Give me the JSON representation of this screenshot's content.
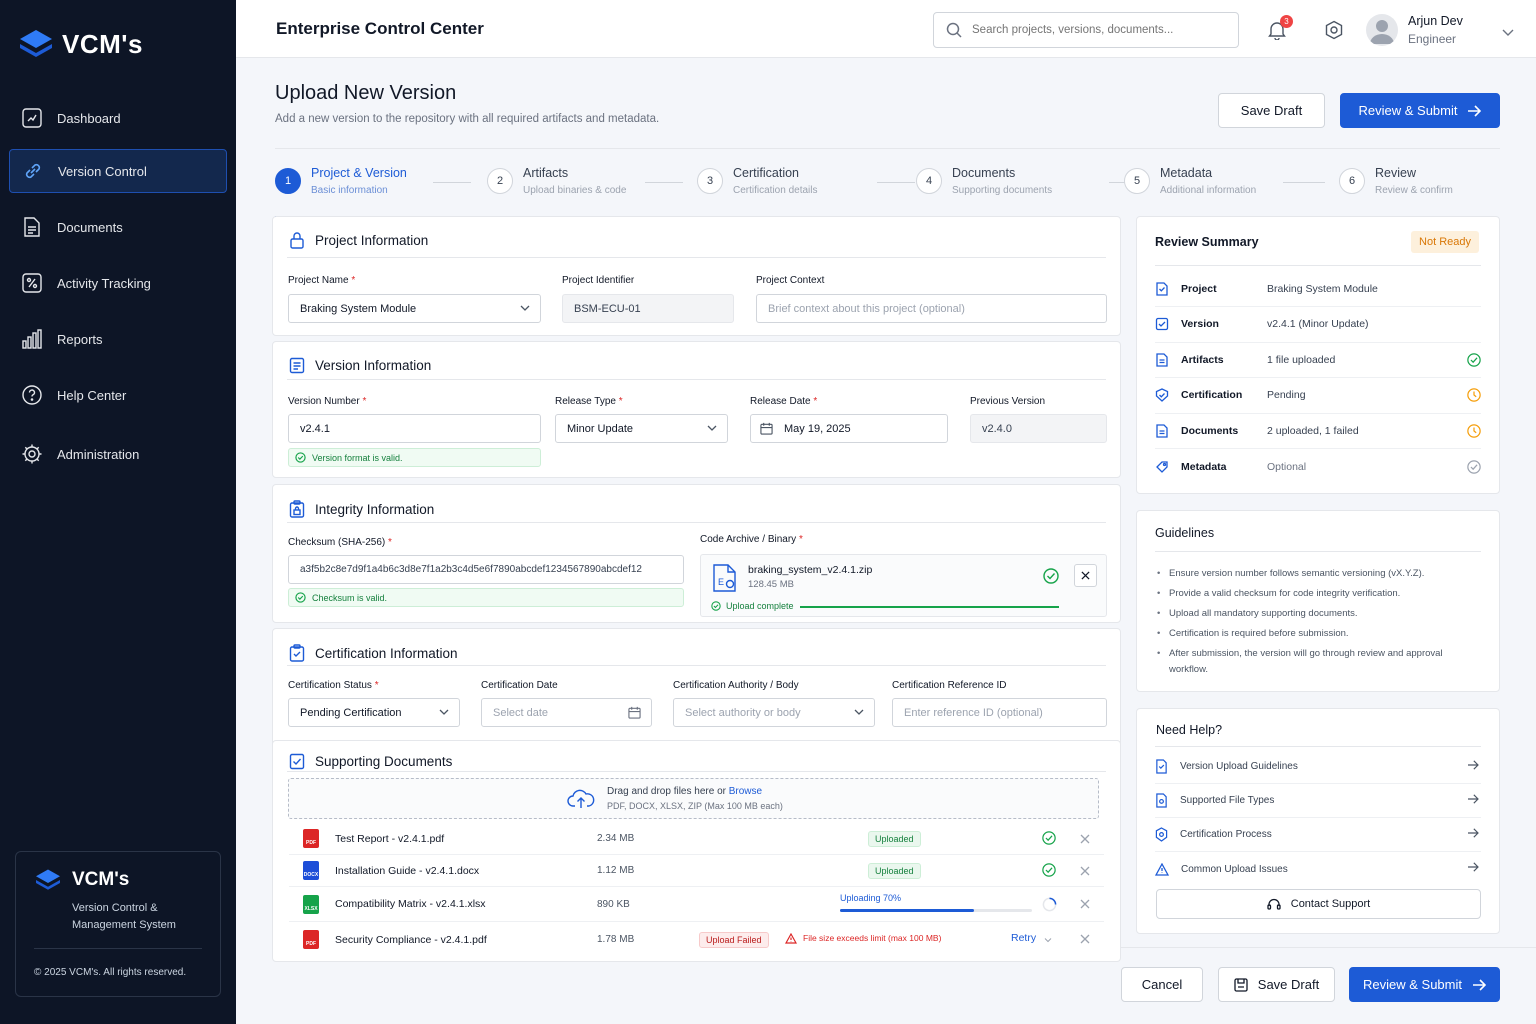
{
  "brand": {
    "name": "VCM's",
    "tagline": "Version Control & Management System",
    "copyright": "© 2025 VCM's. All rights reserved."
  },
  "nav": [
    {
      "label": "Dashboard",
      "icon": "dashboard-icon"
    },
    {
      "label": "Version Control",
      "icon": "link-icon",
      "active": true
    },
    {
      "label": "Documents",
      "icon": "document-icon"
    },
    {
      "label": "Activity Tracking",
      "icon": "activity-icon"
    },
    {
      "label": "Reports",
      "icon": "bar-chart-icon"
    },
    {
      "label": "Help Center",
      "icon": "help-icon"
    },
    {
      "label": "Administration",
      "icon": "gear-icon"
    }
  ],
  "header": {
    "title": "Enterprise Control Center",
    "search_placeholder": "Search projects, versions, documents...",
    "notifications": "3",
    "user_name": "Arjun Dev",
    "user_role": "Engineer"
  },
  "page": {
    "title": "Upload New Version",
    "subtitle": "Add a new version to the repository with all required artifacts and metadata.",
    "save_draft": "Save Draft",
    "review_submit": "Review & Submit"
  },
  "steps": [
    {
      "num": "1",
      "title": "Project & Version",
      "sub": "Basic information"
    },
    {
      "num": "2",
      "title": "Artifacts",
      "sub": "Upload binaries & code"
    },
    {
      "num": "3",
      "title": "Certification",
      "sub": "Certification details"
    },
    {
      "num": "4",
      "title": "Documents",
      "sub": "Supporting documents"
    },
    {
      "num": "5",
      "title": "Metadata",
      "sub": "Additional information"
    },
    {
      "num": "6",
      "title": "Review",
      "sub": "Review & confirm"
    }
  ],
  "project": {
    "title": "Project Information",
    "name_label": "Project Name",
    "name_value": "Braking System Module",
    "id_label": "Project Identifier",
    "id_value": "BSM-ECU-01",
    "context_label": "Project Context",
    "context_placeholder": "Brief context about this project (optional)"
  },
  "version": {
    "title": "Version Information",
    "number_label": "Version Number",
    "number_value": "v2.4.1",
    "valid": "Version format is valid.",
    "type_label": "Release Type",
    "type_value": "Minor Update",
    "date_label": "Release Date",
    "date_value": "May 19, 2025",
    "prev_label": "Previous Version",
    "prev_value": "v2.4.0"
  },
  "integrity": {
    "title": "Integrity Information",
    "checksum_label": "Checksum (SHA-256)",
    "checksum_value": "a3f5b2c8e7d9f1a4b6c3d8e7f1a2b3c4d5e6f7890abcdef1234567890abcdef12",
    "checksum_valid": "Checksum is valid.",
    "archive_label": "Code Archive / Binary",
    "file_name": "braking_system_v2.4.1.zip",
    "file_size": "128.45 MB",
    "upload_status": "Upload complete",
    "upload_progress": 1.0
  },
  "certification": {
    "title": "Certification Information",
    "status_label": "Certification Status",
    "status_value": "Pending Certification",
    "date_label": "Certification Date",
    "date_placeholder": "Select date",
    "authority_label": "Certification Authority / Body",
    "authority_placeholder": "Select authority or body",
    "ref_label": "Certification Reference ID",
    "ref_placeholder": "Enter reference ID (optional)"
  },
  "documents": {
    "title": "Supporting Documents",
    "drop_text": "Drag and drop files here or",
    "browse": "Browse",
    "formats": "PDF, DOCX, XLSX, ZIP (Max 100 MB each)",
    "files": [
      {
        "name": "Test Report - v2.4.1.pdf",
        "size": "2.34 MB",
        "status": "Uploaded",
        "type": "pdf"
      },
      {
        "name": "Installation Guide - v2.4.1.docx",
        "size": "1.12 MB",
        "status": "Uploaded",
        "type": "docx"
      },
      {
        "name": "Compatibility Matrix - v2.4.1.xlsx",
        "size": "890 KB",
        "status": "Uploading 70%",
        "progress": 0.7,
        "type": "xlsx"
      },
      {
        "name": "Security Compliance - v2.4.1.pdf",
        "size": "1.78 MB",
        "status": "Upload Failed",
        "error": "File size exceeds limit (max 100 MB)",
        "retry": "Retry",
        "type": "pdf"
      }
    ]
  },
  "summary": {
    "title": "Review Summary",
    "badge": "Not Ready",
    "rows": [
      {
        "key": "Project",
        "value": "Braking System Module",
        "state": "none"
      },
      {
        "key": "Version",
        "value": "v2.4.1 (Minor Update)",
        "state": "none"
      },
      {
        "key": "Artifacts",
        "value": "1 file uploaded",
        "state": "ok"
      },
      {
        "key": "Certification",
        "value": "Pending",
        "state": "warn"
      },
      {
        "key": "Documents",
        "value": "2 uploaded, 1 failed",
        "state": "warn"
      },
      {
        "key": "Metadata",
        "value": "Optional",
        "state": "muted"
      }
    ]
  },
  "guidelines": {
    "title": "Guidelines",
    "items": [
      "Ensure version number follows semantic versioning (vX.Y.Z).",
      "Provide a valid checksum for code integrity verification.",
      "Upload all mandatory supporting documents.",
      "Certification is required before submission.",
      "After submission, the version will go through review and approval workflow."
    ]
  },
  "help": {
    "title": "Need Help?",
    "items": [
      "Version Upload Guidelines",
      "Supported File Types",
      "Certification Process",
      "Common Upload Issues"
    ],
    "contact": "Contact Support"
  },
  "footer": {
    "cancel": "Cancel",
    "save_draft": "Save Draft",
    "review_submit": "Review & Submit"
  },
  "colors": {
    "primary": "#1d5bd6",
    "sidebar": "#0d1526",
    "success": "#16a34a",
    "warning": "#f59e0b",
    "danger": "#dc2626"
  }
}
